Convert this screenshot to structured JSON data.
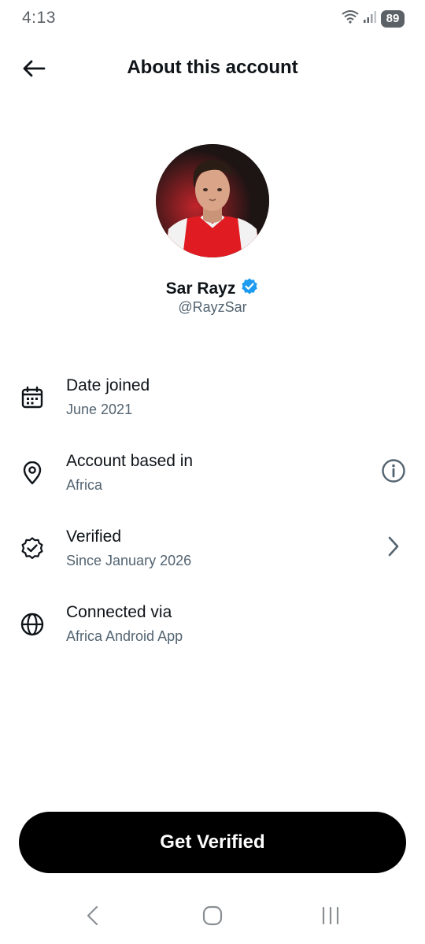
{
  "status_bar": {
    "time": "4:13",
    "battery": "89"
  },
  "header": {
    "title": "About this account"
  },
  "profile": {
    "display_name": "Sar Rayz",
    "handle": "@RayzSar"
  },
  "info_rows": [
    {
      "label": "Date joined",
      "value": "June 2021",
      "icon": "calendar-icon"
    },
    {
      "label": "Account based in",
      "value": "Africa",
      "icon": "location-pin-icon",
      "action_icon": "info-icon"
    },
    {
      "label": "Verified",
      "value": "Since January 2026",
      "icon": "verified-badge-icon",
      "action_icon": "chevron-right-icon"
    },
    {
      "label": "Connected via",
      "value": "Africa Android App",
      "icon": "globe-icon"
    }
  ],
  "cta": {
    "label": "Get Verified"
  },
  "colors": {
    "verified_blue": "#1d9bf0",
    "text_primary": "#0f1419",
    "text_secondary": "#536471",
    "cta_bg": "#000000"
  }
}
